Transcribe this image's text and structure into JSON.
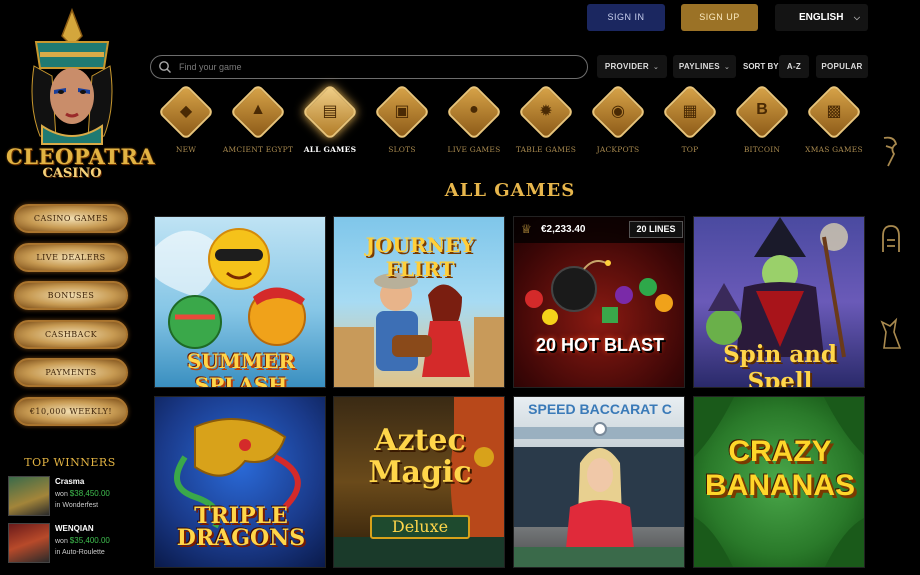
{
  "brand": {
    "title": "CLEOPATRA",
    "subtitle": "CASINO"
  },
  "header": {
    "signin_label": "SIGN IN",
    "signup_label": "SIGN UP",
    "language": "ENGLISH"
  },
  "search": {
    "placeholder": "Find your game"
  },
  "filters": {
    "provider": "PROVIDER",
    "paylines": "PAYLINES",
    "sort_by": "SORT BY",
    "sort_az": "A-Z",
    "popular": "POPULAR"
  },
  "categories": [
    {
      "label": "NEW",
      "icon": "gem-icon"
    },
    {
      "label": "AMCIENT EGYPT",
      "icon": "pyramid-icon"
    },
    {
      "label": "ALL GAMES",
      "icon": "column-icon",
      "active": true
    },
    {
      "label": "SLOTS",
      "icon": "slot-machine-icon"
    },
    {
      "label": "LIVE GAMES",
      "icon": "dealer-icon"
    },
    {
      "label": "TABLE GAMES",
      "icon": "roulette-icon"
    },
    {
      "label": "JACKPOTS",
      "icon": "trophy-icon"
    },
    {
      "label": "TOP",
      "icon": "temple-icon"
    },
    {
      "label": "BITCOIN",
      "icon": "bitcoin-icon"
    },
    {
      "label": "XMAS GAMES",
      "icon": "gift-icon"
    }
  ],
  "section_title": "ALL GAMES",
  "side_menu": [
    "CASINO GAMES",
    "LIVE DEALERS",
    "BONUSES",
    "CASHBACK",
    "PAYMENTS",
    "€10,000 WEEKLY!"
  ],
  "top_winners": {
    "title": "TOP WINNERS",
    "items": [
      {
        "name": "Crasma",
        "prefix": "won",
        "amount": "$38,450.00",
        "game": "in Wonderfest"
      },
      {
        "name": "WENQIAN",
        "prefix": "won",
        "amount": "$35,400.00",
        "game": "in Auto-Roulette"
      }
    ]
  },
  "games": [
    {
      "title": "SUMMER SPLASH"
    },
    {
      "title": "JOURNEY FLIRT"
    },
    {
      "title": "20 HOT BLAST",
      "jackpot": "€2,233.40",
      "lines": "20 LINES"
    },
    {
      "title": "Spin and Spell"
    },
    {
      "title": "TRIPLE DRAGONS"
    },
    {
      "title": "Aztec Magic",
      "subtitle": "Deluxe"
    },
    {
      "title": "SPEED BACCARAT C"
    },
    {
      "title": "CRAZY BANANAS"
    }
  ],
  "colors": {
    "gold": "#e2b343",
    "signin_bg": "#1b2760",
    "signup_bg": "#9b7226",
    "win_amount": "#3fbf4f"
  }
}
